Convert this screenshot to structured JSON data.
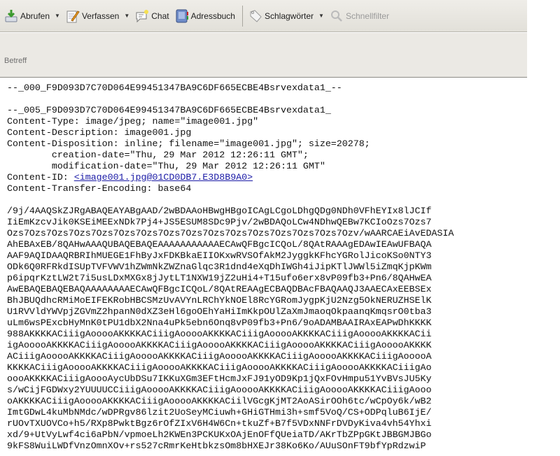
{
  "toolbar": {
    "abrufen": "Abrufen",
    "verfassen": "Verfassen",
    "chat": "Chat",
    "adressbuch": "Adressbuch",
    "schlagwoerter": "Schlagwörter",
    "schnellfilter": "Schnellfilter"
  },
  "header": {
    "betreff_label": "Betreff"
  },
  "message": {
    "boundary_end": "--_000_F9D093D7C70D064E99451347BA9C6DF665ECBE4Bsrvexdata1_--",
    "boundary_start": "--_005_F9D093D7C70D064E99451347BA9C6DF665ECBE4Bsrvexdata1_",
    "content_type": "Content-Type: image/jpeg; name=\"image001.jpg\"",
    "content_description": "Content-Description: image001.jpg",
    "content_disposition": "Content-Disposition: inline; filename=\"image001.jpg\"; size=20278;",
    "creation_date": "        creation-date=\"Thu, 29 Mar 2012 12:26:11 GMT\";",
    "modification_date": "        modification-date=\"Thu, 29 Mar 2012 12:26:11 GMT\"",
    "content_id_label": "Content-ID: ",
    "content_id_link": "<image001.jpg@01CD0DB7.E3D8B9A0>",
    "transfer_encoding": "Content-Transfer-Encoding: base64",
    "base64_lines": [
      "/9j/4AAQSkZJRgABAQEAYABgAAD/2wBDAAoHBwgHBgoICAgLCgoLDhgQDg0NDh0VFhEYIx8lJCIf",
      "IiEmKzcvJik0KSEiMEExNDk7Pj4+JS5ESUM8SDc9Pjv/2wBDAQoLCw4NDhwQEBw7KCIoOzs7Ozs7",
      "Ozs7Ozs7Ozs7Ozs7Ozs7Ozs7Ozs7Ozs7Ozs7Ozs7Ozs7Ozs7Ozs7Ozs7Ozs7Ozv/wAARCAEiAvEDASIA",
      "AhEBAxEB/8QAHwAAAQUBAQEBAQEAAAAAAAAAAAECAwQFBgcICQoL/8QAtRAAAgEDAwIEAwUFBAQA",
      "AAF9AQIDAAQRBRIhMUEGE1FhByJxFDKBkaEIIOKxwRVSOfAkM2JyggkKFhcYGRolJicoKSo0NTY3",
      "ODk6Q0RFRkdISUpTVFVWV1hZWmNkZWZnaGlqc3R1dnd4eXqDhIWGh4iJipKTlJWWl5iZmqKjpKWm",
      "p6ipqrKztLW2t7i5usLDxMXGx8jJytLT1NXW19jZ2uHi4+T15ufo6erx8vP09fb3+Pn6/8QAHwEA",
      "AwEBAQEBAQEBAQAAAAAAAAECAwQFBgcICQoL/8QAtREAAgECBAQDBAcFBAQAAQJ3AAECAxEEBSEx",
      "BhJBUQdhcRMiMoEIFEKRobHBCSMzUvAVYnLRChYkNOEl8RcYGRomJygpKjU2Nzg5OkNERUZHSElK",
      "U1RVVldYWVpjZGVmZ2hpanN0dXZ3eHl6goOEhYaHiImKkpOUlZaXmJmaoqOkpaanqKmqsrO0tba3",
      "uLm6wsPExcbHyMnK0tPU1dbX2Nna4uPk5ebn6Onq8vP09fb3+Pn6/9oADAMBAAIRAxEAPwDhKKKK",
      "988AKKKKACiiigAooooAKKKKACiiigAooooAKKKKACiiigAooooAKKKKACiiigAooooAKKKKACii",
      "igAooooAKKKKACiiigAooooAKKKKACiiigAooooAKKKKACiiigAooooAKKKKACiiigAooooAKKKK",
      "ACiiigAooooAKKKKACiiigAooooAKKKKACiiigAooooAKKKKACiiigAooooAKKKKACiiigAooooA",
      "KKKKACiiigAooooAKKKKACiiigAooooAKKKKACiiigAooooAKKKKACiiigAooooAKKKKACiiigAo",
      "oooAKKKKACiiigAoooAycUbDSu7IKKuXGm3EFtHcmJxFJ91yOD9Kp1jQxFOvHmpu51YvBVsJU5Ky",
      "s/wCijFGDWxy2YUUUUCCiiigAooooAKKKKACiiigAooooAKKKKACiiigAooooAKKKKACiiigAooo",
      "oAKKKKACiiigAooooAKKKKACiiigAooooAKKKKACiilVGcgKjMT2AoASirOOh6tc/wCpOy6k/wB2",
      "ImtGDwL4kuMbNMdc/wDPRgv86lzit2UoSeyMCiuwh+GHiGTHmi3h+smf5VoQ/CS+ODPqluB6IjE/",
      "rUOvTXUOVCo+h5/RXp8PwktBgz6rOfZIxV6H4W6Cn+tkuZf+B7f5VDxNNFrDVDyKiva4vh54Yhxi",
      "xd/9+UtVyLwf4ci6aPbN/vpmoeLh2KWEn3PCKUKxOAjEnOFfQUeiaTD/AKrTbZPpGKtJBBGMJBGo",
      "9kFS8WuiLWDfVnzOmnXOv+rs527cRmrKeHtbkzsOm8bHXEJr38Ko6Ko/AUuSOnFT9bfYpRdzwiP"
    ]
  }
}
